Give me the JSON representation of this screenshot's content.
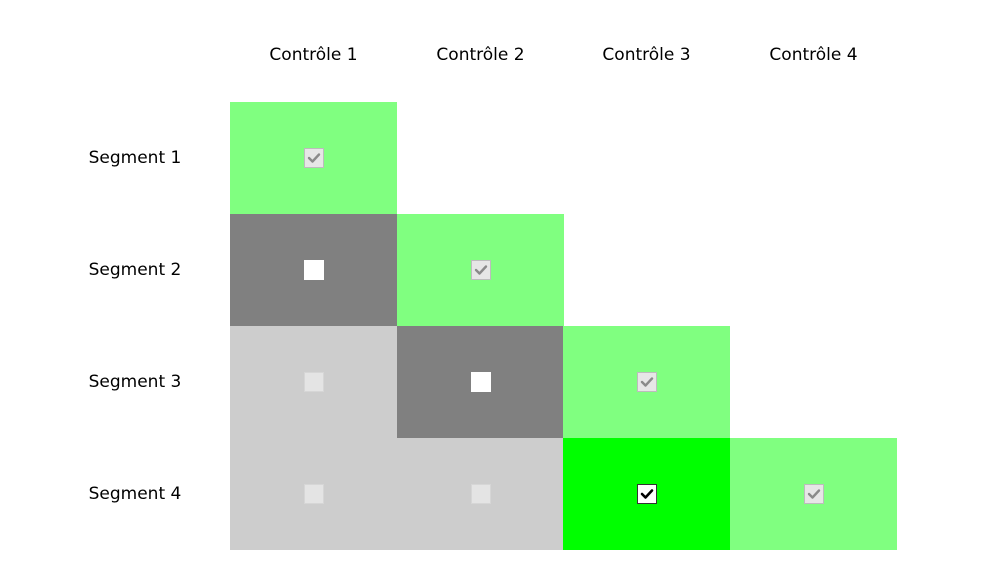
{
  "columns": [
    {
      "label": "Contrôle 1"
    },
    {
      "label": "Contrôle 2"
    },
    {
      "label": "Contrôle 3"
    },
    {
      "label": "Contrôle 4"
    }
  ],
  "rows": [
    {
      "label": "Segment 1"
    },
    {
      "label": "Segment 2"
    },
    {
      "label": "Segment 3"
    },
    {
      "label": "Segment 4"
    }
  ],
  "colors": {
    "light_green": "#80ff80",
    "bright_green": "#00ff00",
    "dark_gray": "#808080",
    "light_gray": "#cdcdcd"
  },
  "cells": [
    {
      "row": 1,
      "col": 1,
      "state": "checked",
      "enabled": false,
      "color": "light_green"
    },
    {
      "row": 2,
      "col": 1,
      "state": "unchecked",
      "enabled": true,
      "color": "dark_gray"
    },
    {
      "row": 2,
      "col": 2,
      "state": "checked",
      "enabled": false,
      "color": "light_green"
    },
    {
      "row": 3,
      "col": 1,
      "state": "unchecked",
      "enabled": false,
      "color": "light_gray"
    },
    {
      "row": 3,
      "col": 2,
      "state": "unchecked",
      "enabled": true,
      "color": "dark_gray"
    },
    {
      "row": 3,
      "col": 3,
      "state": "checked",
      "enabled": false,
      "color": "light_green"
    },
    {
      "row": 4,
      "col": 1,
      "state": "unchecked",
      "enabled": false,
      "color": "light_gray"
    },
    {
      "row": 4,
      "col": 2,
      "state": "unchecked",
      "enabled": false,
      "color": "light_gray"
    },
    {
      "row": 4,
      "col": 3,
      "state": "checked",
      "enabled": true,
      "color": "bright_green"
    },
    {
      "row": 4,
      "col": 4,
      "state": "checked",
      "enabled": false,
      "color": "light_green"
    }
  ]
}
